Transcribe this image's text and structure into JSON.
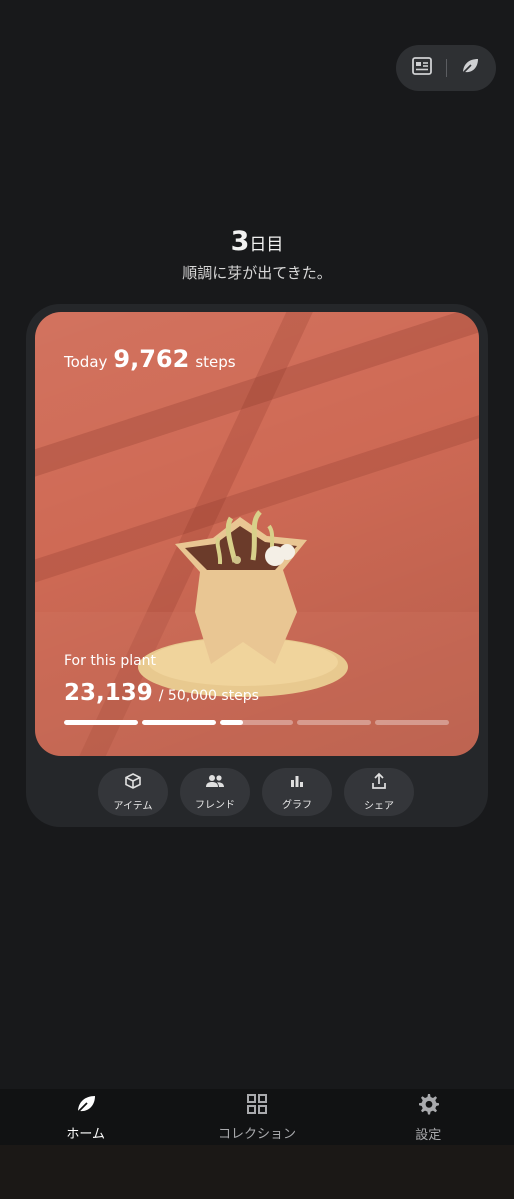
{
  "header": {
    "day_number": "3",
    "day_unit": "日目",
    "subtitle": "順調に芽が出てきた。"
  },
  "top_toggle": {
    "left_icon": "news-icon",
    "right_icon": "leaf-icon"
  },
  "card": {
    "today_prefix": "Today",
    "today_steps": "9,762",
    "today_suffix": "steps",
    "plant_label": "For this plant",
    "plant_steps": "23,139",
    "plant_goal": "/ 50,000 steps",
    "progress_fraction": 0.463
  },
  "actions": [
    {
      "label": "アイテム",
      "icon": "box-icon"
    },
    {
      "label": "フレンド",
      "icon": "friends-icon"
    },
    {
      "label": "グラフ",
      "icon": "chart-icon"
    },
    {
      "label": "シェア",
      "icon": "share-icon"
    }
  ],
  "nav": [
    {
      "label": "ホーム",
      "icon": "leaf-icon",
      "active": true
    },
    {
      "label": "コレクション",
      "icon": "grid-icon",
      "active": false
    },
    {
      "label": "設定",
      "icon": "gear-icon",
      "active": false
    }
  ]
}
